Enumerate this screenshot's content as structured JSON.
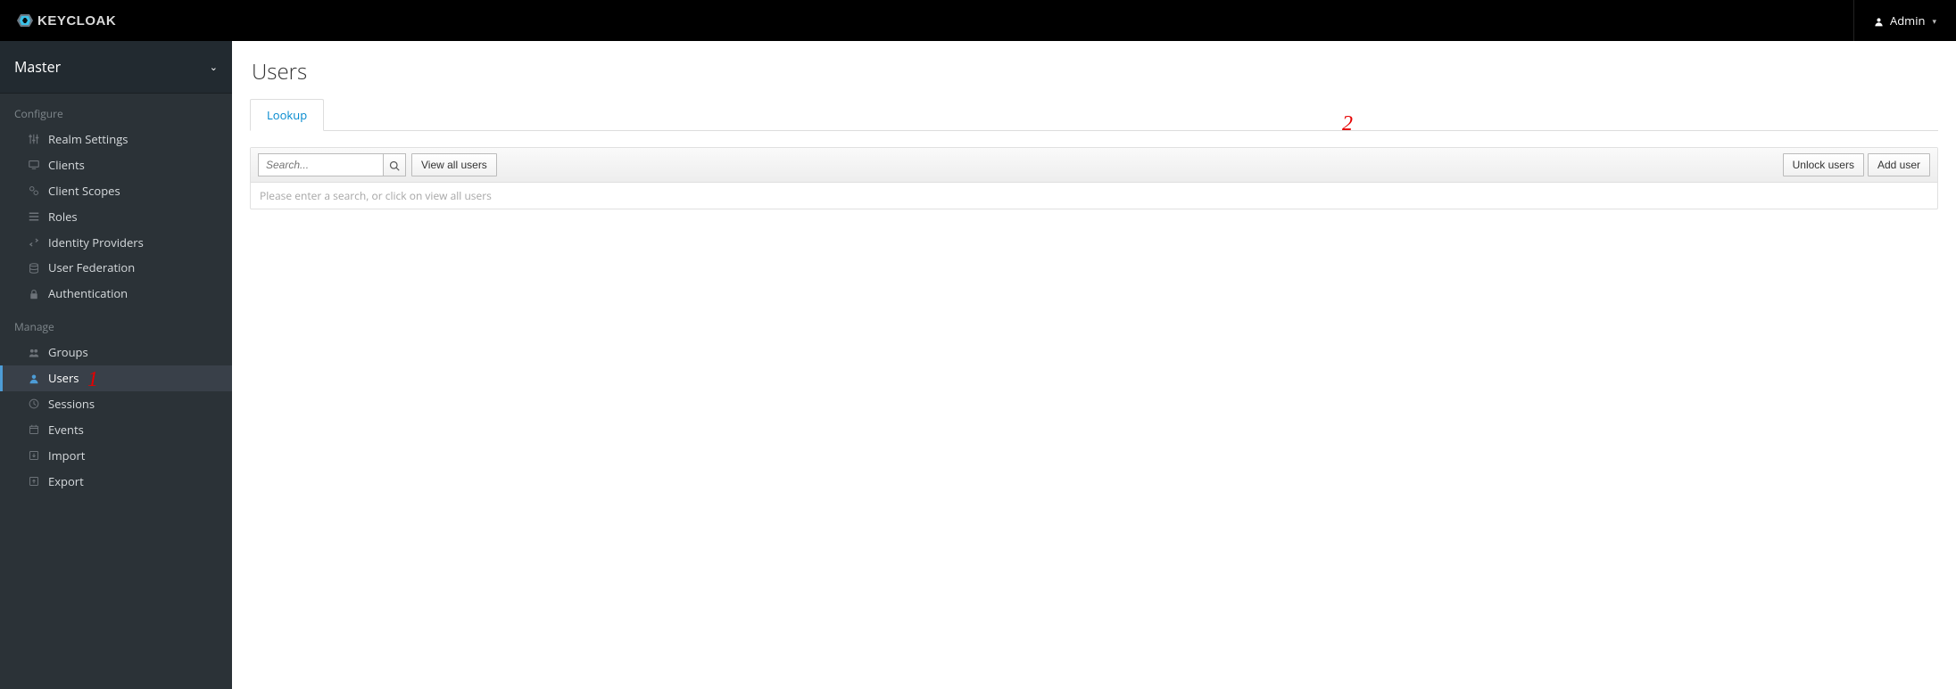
{
  "brand": "KEYCLOAK",
  "header": {
    "user_label": "Admin"
  },
  "realm": {
    "name": "Master"
  },
  "sidebar": {
    "sections": [
      {
        "label": "Configure",
        "items": [
          {
            "id": "realm-settings",
            "label": "Realm Settings",
            "icon": "sliders"
          },
          {
            "id": "clients",
            "label": "Clients",
            "icon": "desktop"
          },
          {
            "id": "client-scopes",
            "label": "Client Scopes",
            "icon": "scopes"
          },
          {
            "id": "roles",
            "label": "Roles",
            "icon": "list"
          },
          {
            "id": "identity-providers",
            "label": "Identity Providers",
            "icon": "exchange"
          },
          {
            "id": "user-federation",
            "label": "User Federation",
            "icon": "database"
          },
          {
            "id": "authentication",
            "label": "Authentication",
            "icon": "lock"
          }
        ]
      },
      {
        "label": "Manage",
        "items": [
          {
            "id": "groups",
            "label": "Groups",
            "icon": "group"
          },
          {
            "id": "users",
            "label": "Users",
            "icon": "user",
            "active": true
          },
          {
            "id": "sessions",
            "label": "Sessions",
            "icon": "clock"
          },
          {
            "id": "events",
            "label": "Events",
            "icon": "calendar"
          },
          {
            "id": "import",
            "label": "Import",
            "icon": "import"
          },
          {
            "id": "export",
            "label": "Export",
            "icon": "export"
          }
        ]
      }
    ]
  },
  "page": {
    "title": "Users",
    "tabs": [
      {
        "label": "Lookup",
        "active": true
      }
    ],
    "search_placeholder": "Search...",
    "view_all_label": "View all users",
    "unlock_label": "Unlock users",
    "add_label": "Add user",
    "empty_message": "Please enter a search, or click on view all users"
  },
  "annotations": {
    "a1": "1",
    "a2": "2"
  }
}
